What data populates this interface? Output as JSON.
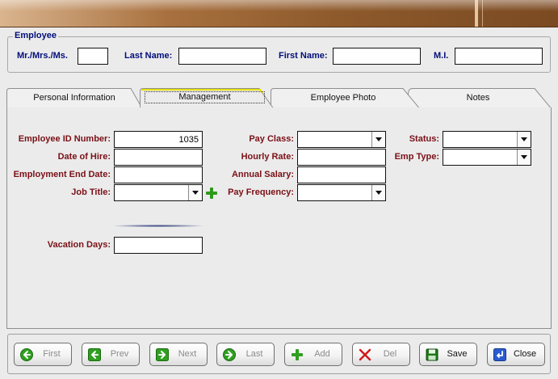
{
  "employee_group": {
    "title": "Employee",
    "salutation_label": "Mr./Mrs./Ms.",
    "salutation_value": "",
    "last_name_label": "Last Name:",
    "last_name_value": "",
    "first_name_label": "First Name:",
    "first_name_value": "",
    "mi_label": "M.I.",
    "mi_value": ""
  },
  "tabs": [
    {
      "label": "Personal Information",
      "active": false
    },
    {
      "label": "Management",
      "active": true
    },
    {
      "label": "Employee Photo",
      "active": false
    },
    {
      "label": "Notes",
      "active": false
    }
  ],
  "management": {
    "employee_id_label": "Employee ID Number:",
    "employee_id_value": "1035",
    "date_of_hire_label": "Date of Hire:",
    "date_of_hire_value": "",
    "employment_end_label": "Employment End Date:",
    "employment_end_value": "",
    "job_title_label": "Job Title:",
    "job_title_value": "",
    "vacation_days_label": "Vacation Days:",
    "vacation_days_value": "",
    "pay_class_label": "Pay Class:",
    "pay_class_value": "",
    "hourly_rate_label": "Hourly Rate:",
    "hourly_rate_value": "",
    "annual_salary_label": "Annual Salary:",
    "annual_salary_value": "",
    "pay_frequency_label": "Pay Frequency:",
    "pay_frequency_value": "",
    "status_label": "Status:",
    "status_value": "",
    "emp_type_label": "Emp Type:",
    "emp_type_value": ""
  },
  "buttons": {
    "first": "First",
    "prev": "Prev",
    "next": "Next",
    "last": "Last",
    "add": "Add",
    "del": "Del",
    "save": "Save",
    "close": "Close"
  },
  "colors": {
    "title_bar": "#8e5a2c",
    "label_blue": "#000e7a",
    "label_maroon": "#7a1016",
    "active_tab_accent": "#e8e000",
    "icon_green": "#2f9f1f"
  }
}
